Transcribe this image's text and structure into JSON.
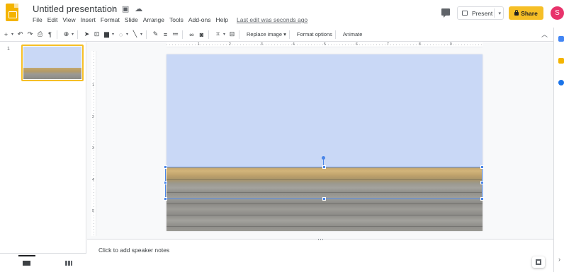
{
  "header": {
    "doc_title": "Untitled presentation",
    "menu": [
      "File",
      "Edit",
      "View",
      "Insert",
      "Format",
      "Slide",
      "Arrange",
      "Tools",
      "Add-ons",
      "Help"
    ],
    "last_edit": "Last edit was seconds ago",
    "present_label": "Present",
    "share_label": "Share",
    "avatar_initial": "S"
  },
  "toolbar": {
    "replace_image_label": "Replace image ▾",
    "format_options_label": "Format options",
    "animate_label": "Animate"
  },
  "filmstrip": {
    "slides": [
      {
        "number": "1"
      }
    ]
  },
  "rulers": {
    "top_ticks": [
      "1",
      "2",
      "3",
      "4",
      "5",
      "6",
      "7",
      "8",
      "9"
    ],
    "left_ticks": [
      "1",
      "2",
      "3",
      "4",
      "5"
    ]
  },
  "notes": {
    "placeholder": "Click to add speaker notes"
  },
  "colors": {
    "accent": "#4a86e8",
    "share_button": "#f6bf26",
    "slide_background": "#c9d8f6",
    "avatar": "#e8336b"
  }
}
